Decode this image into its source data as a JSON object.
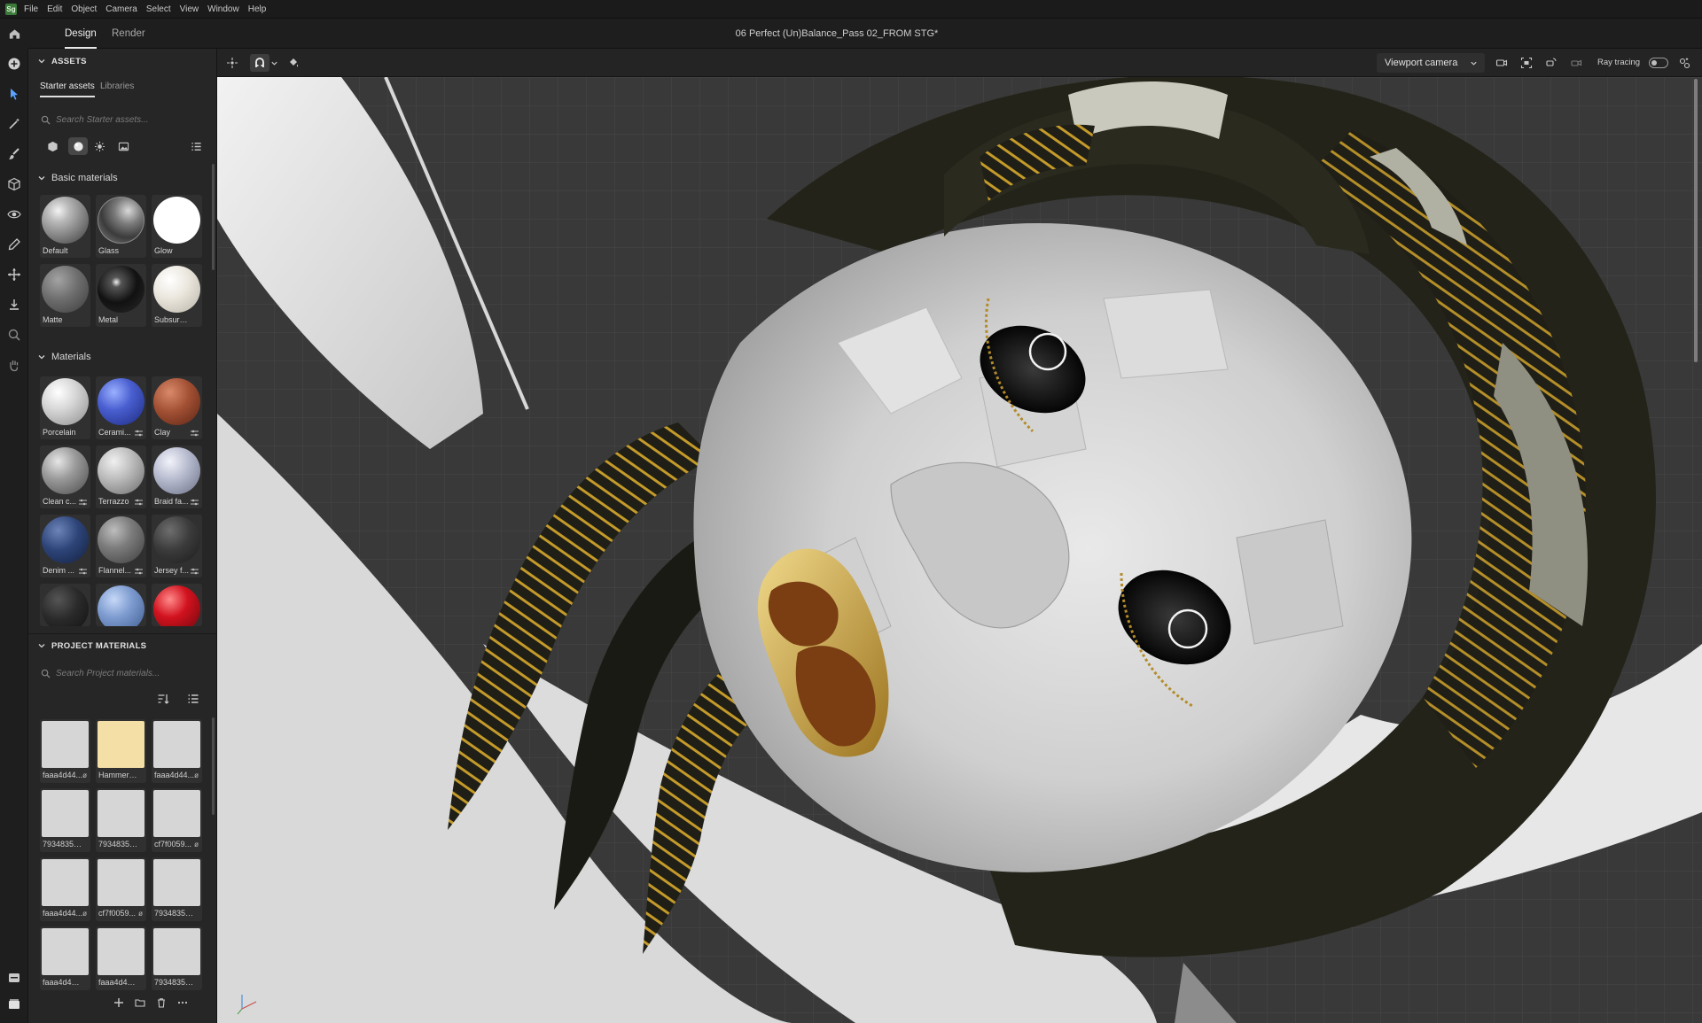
{
  "app": {
    "logo": "Sg",
    "title": "06 Perfect (Un)Balance_Pass 02_FROM STG*"
  },
  "menu": [
    "File",
    "Edit",
    "Object",
    "Camera",
    "Select",
    "View",
    "Window",
    "Help"
  ],
  "tabs": {
    "design": "Design",
    "render": "Render"
  },
  "assets": {
    "heading": "ASSETS",
    "tabs": {
      "starter": "Starter assets",
      "libraries": "Libraries"
    },
    "search_placeholder": "Search Starter assets...",
    "basic_heading": "Basic materials",
    "basic": [
      {
        "label": "Default",
        "color": "#9a9a9a"
      },
      {
        "label": "Glass",
        "color": "#6f6f6f"
      },
      {
        "label": "Glow",
        "color": "#ffffff"
      },
      {
        "label": "Matte",
        "color": "#7a7a7a"
      },
      {
        "label": "Metal",
        "color": "#1b1b1b"
      },
      {
        "label": "Subsurface",
        "color": "#e7e3da"
      }
    ],
    "materials_heading": "Materials",
    "materials": [
      {
        "label": "Porcelain",
        "adj": false
      },
      {
        "label": "Cerami...",
        "adj": true
      },
      {
        "label": "Clay",
        "adj": true
      },
      {
        "label": "Clean c...",
        "adj": true
      },
      {
        "label": "Terrazzo",
        "adj": true
      },
      {
        "label": "Braid fa...",
        "adj": true
      },
      {
        "label": "Denim ...",
        "adj": true
      },
      {
        "label": "Flannel...",
        "adj": true
      },
      {
        "label": "Jersey f...",
        "adj": true
      },
      {
        "label": "",
        "adj": false
      },
      {
        "label": "",
        "adj": false
      },
      {
        "label": "",
        "adj": false
      }
    ]
  },
  "project": {
    "heading": "PROJECT MATERIALS",
    "search_placeholder": "Search Project materials...",
    "items": [
      {
        "label": "faaa4d44..."
      },
      {
        "label": "Hammere..."
      },
      {
        "label": "faaa4d44..."
      },
      {
        "label": "793483574..."
      },
      {
        "label": "793483574..."
      },
      {
        "label": "cf7f0059..."
      },
      {
        "label": "faaa4d44..."
      },
      {
        "label": "cf7f0059..."
      },
      {
        "label": "793483574..."
      },
      {
        "label": "faaa4d44f..."
      },
      {
        "label": "faaa4d44f..."
      },
      {
        "label": "793483574..."
      }
    ]
  },
  "viewport": {
    "camera": "Viewport camera",
    "ray_tracing": "Ray tracing",
    "ray_tracing_on": false
  },
  "colors": {
    "accent": "#e8e8e8",
    "panel": "#262626",
    "viewport_grid": "#3a3a3a"
  }
}
